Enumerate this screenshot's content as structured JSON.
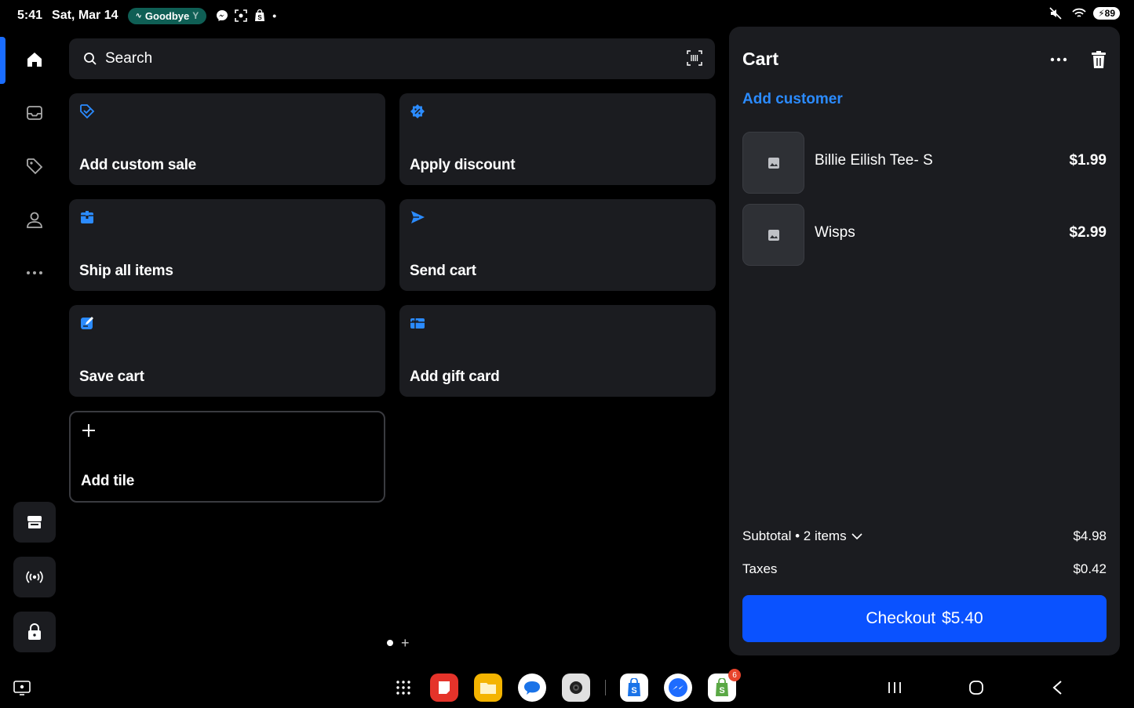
{
  "status_bar": {
    "time": "5:41",
    "date": "Sat, Mar 14",
    "media_pill": "Goodbye",
    "battery": "89"
  },
  "rail": {
    "items": [
      "home-icon",
      "inbox-icon",
      "tag-icon",
      "person-icon",
      "more-horizontal-icon"
    ],
    "bottom_buttons": [
      "store-icon",
      "broadcast-icon",
      "lock-icon"
    ]
  },
  "search": {
    "placeholder": "Search"
  },
  "tiles": [
    {
      "label": "Add custom sale",
      "icon": "tag-check-icon"
    },
    {
      "label": "Apply discount",
      "icon": "discount-badge-icon"
    },
    {
      "label": "Ship all items",
      "icon": "shipping-box-icon"
    },
    {
      "label": "Send cart",
      "icon": "send-icon"
    },
    {
      "label": "Save cart",
      "icon": "save-edit-icon"
    },
    {
      "label": "Add gift card",
      "icon": "gift-card-icon"
    },
    {
      "label": "Add tile",
      "icon": "plus-icon"
    }
  ],
  "cart": {
    "title": "Cart",
    "add_customer": "Add customer",
    "items": [
      {
        "name": "Billie Eilish Tee- S",
        "price": "$1.99"
      },
      {
        "name": "Wisps",
        "price": "$2.99"
      }
    ],
    "subtotal_label": "Subtotal • 2 items",
    "subtotal_value": "$4.98",
    "taxes_label": "Taxes",
    "taxes_value": "$0.42",
    "checkout_label": "Checkout",
    "checkout_total": "$5.40"
  },
  "navbar": {
    "apps": [
      "apps-grid-icon",
      "notes-app-icon",
      "files-app-icon",
      "messages-app-icon",
      "camera-app-icon",
      "shopify-pos-app-icon",
      "messenger-app-icon",
      "shopify-app-icon"
    ],
    "shopify_badge": "6",
    "accent": "#0a52ff"
  }
}
